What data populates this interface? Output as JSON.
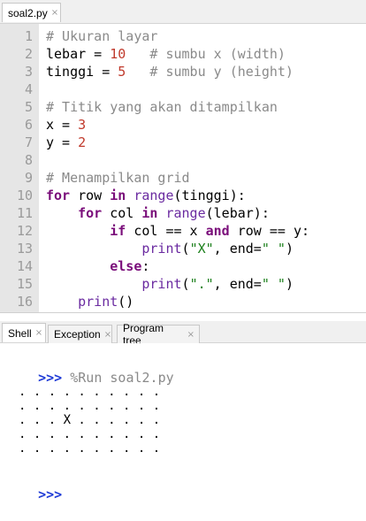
{
  "editor": {
    "tab_label": "soal2.py",
    "line_numbers": [
      "1",
      "2",
      "3",
      "4",
      "5",
      "6",
      "7",
      "8",
      "9",
      "10",
      "11",
      "12",
      "13",
      "14",
      "15",
      "16"
    ]
  },
  "code": {
    "l1_comment": "# Ukuran layar",
    "l2_var": "lebar",
    "l2_eq": " = ",
    "l2_num": "10",
    "l2_comment": "   # sumbu x (width)",
    "l3_var": "tinggi",
    "l3_eq": " = ",
    "l3_num": "5",
    "l3_comment": "   # sumbu y (height)",
    "l5_comment": "# Titik yang akan ditampilkan",
    "l6_var": "x",
    "l6_eq": " = ",
    "l6_num": "3",
    "l7_var": "y",
    "l7_eq": " = ",
    "l7_num": "2",
    "l9_comment": "# Menampilkan grid",
    "l10_for": "for",
    "l10_a": " row ",
    "l10_in": "in",
    "l10_range": "range",
    "l10_b": "(tinggi):",
    "l11_indent": "    ",
    "l11_for": "for",
    "l11_a": " col ",
    "l11_in": "in",
    "l11_range": "range",
    "l11_b": "(lebar):",
    "l12_indent": "        ",
    "l12_if": "if",
    "l12_a": " col == x ",
    "l12_and": "and",
    "l12_b": " row == y:",
    "l13_indent": "            ",
    "l13_print": "print",
    "l13_a": "(",
    "l13_str1": "\"X\"",
    "l13_b": ", end=",
    "l13_str2": "\" \"",
    "l13_c": ")",
    "l14_indent": "        ",
    "l14_else": "else",
    "l14_a": ":",
    "l15_indent": "            ",
    "l15_print": "print",
    "l15_a": "(",
    "l15_str1": "\".\"",
    "l15_b": ", end=",
    "l15_str2": "\" \"",
    "l15_c": ")",
    "l16_indent": "    ",
    "l16_print": "print",
    "l16_a": "()"
  },
  "panels": {
    "tabs": [
      "Shell",
      "Exception",
      "Program tree"
    ],
    "close_glyph": "×"
  },
  "shell": {
    "prompt": ">>>",
    "run_command": " %Run soal2.py",
    "output": [
      ". . . . . . . . . .",
      ". . . . . . . . . .",
      ". . . X . . . . . .",
      ". . . . . . . . . .",
      ". . . . . . . . . ."
    ],
    "final_prompt": ">>>"
  }
}
